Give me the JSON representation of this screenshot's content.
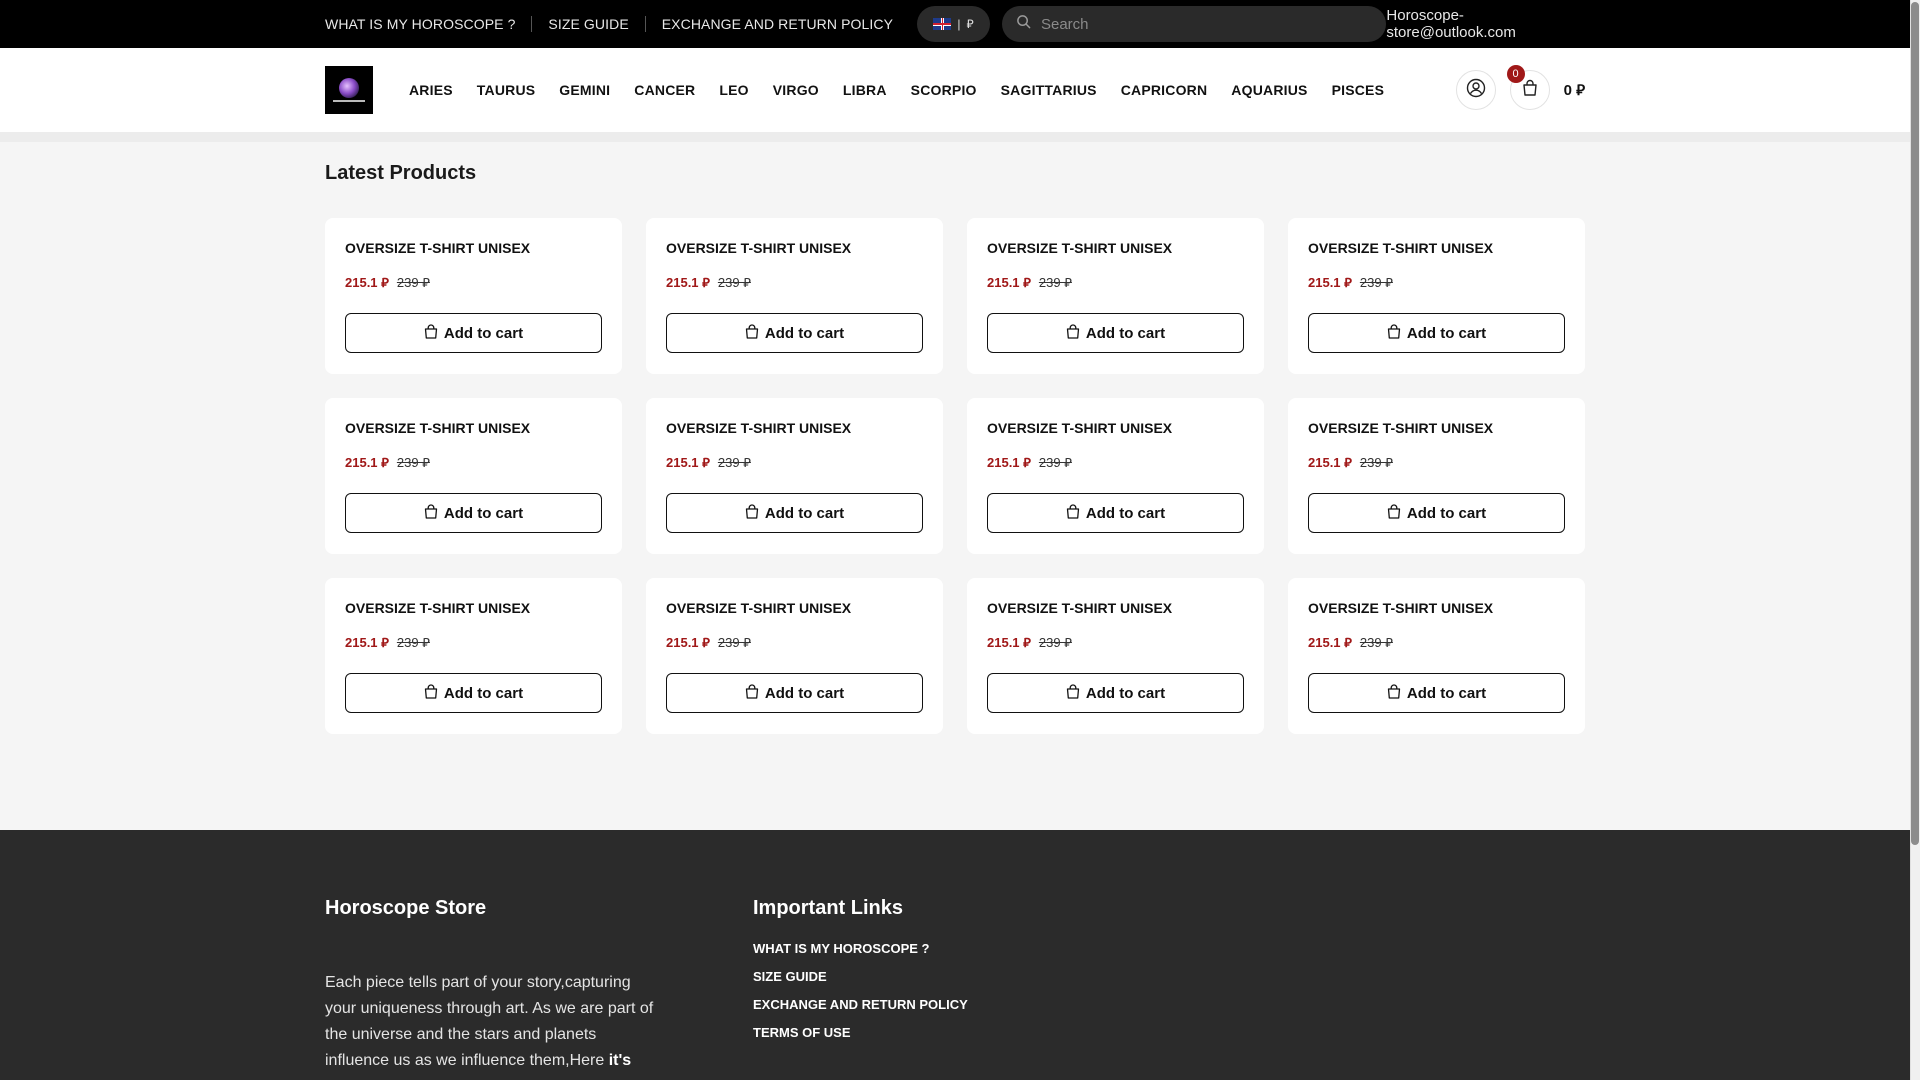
{
  "topbar": {
    "links": [
      "WHAT IS MY HOROSCOPE ?",
      "SIZE GUIDE",
      "EXCHANGE AND RETURN POLICY"
    ],
    "lang_sep": "|",
    "currency_symbol": "⃁",
    "search_placeholder": "Search",
    "email": "Horoscope-store@outlook.com"
  },
  "header": {
    "nav": [
      "ARIES",
      "TAURUS",
      "GEMINI",
      "CANCER",
      "LEO",
      "VIRGO",
      "LIBRA",
      "SCORPIO",
      "SAGITTARIUS",
      "CAPRICORN",
      "AQUARIUS",
      "PISCES"
    ],
    "cart_count": "0",
    "cart_total": "0 ⃁"
  },
  "main": {
    "section_title": "Latest Products",
    "products": [
      {
        "title": "OVERSIZE T-SHIRT UNISEX",
        "price": "215.1 ⃁",
        "old_price": "239 ⃁",
        "button": "Add to cart"
      },
      {
        "title": "OVERSIZE T-SHIRT UNISEX",
        "price": "215.1 ⃁",
        "old_price": "239 ⃁",
        "button": "Add to cart"
      },
      {
        "title": "OVERSIZE T-SHIRT UNISEX",
        "price": "215.1 ⃁",
        "old_price": "239 ⃁",
        "button": "Add to cart"
      },
      {
        "title": "OVERSIZE T-SHIRT UNISEX",
        "price": "215.1 ⃁",
        "old_price": "239 ⃁",
        "button": "Add to cart"
      },
      {
        "title": "OVERSIZE T-SHIRT UNISEX",
        "price": "215.1 ⃁",
        "old_price": "239 ⃁",
        "button": "Add to cart"
      },
      {
        "title": "OVERSIZE T-SHIRT UNISEX",
        "price": "215.1 ⃁",
        "old_price": "239 ⃁",
        "button": "Add to cart"
      },
      {
        "title": "OVERSIZE T-SHIRT UNISEX",
        "price": "215.1 ⃁",
        "old_price": "239 ⃁",
        "button": "Add to cart"
      },
      {
        "title": "OVERSIZE T-SHIRT UNISEX",
        "price": "215.1 ⃁",
        "old_price": "239 ⃁",
        "button": "Add to cart"
      },
      {
        "title": "OVERSIZE T-SHIRT UNISEX",
        "price": "215.1 ⃁",
        "old_price": "239 ⃁",
        "button": "Add to cart"
      },
      {
        "title": "OVERSIZE T-SHIRT UNISEX",
        "price": "215.1 ⃁",
        "old_price": "239 ⃁",
        "button": "Add to cart"
      },
      {
        "title": "OVERSIZE T-SHIRT UNISEX",
        "price": "215.1 ⃁",
        "old_price": "239 ⃁",
        "button": "Add to cart"
      },
      {
        "title": "OVERSIZE T-SHIRT UNISEX",
        "price": "215.1 ⃁",
        "old_price": "239 ⃁",
        "button": "Add to cart"
      }
    ]
  },
  "footer": {
    "store_title": "Horoscope Store",
    "description": "Each piece tells part of your story,capturing your uniqueness through art. As we are part of the universe and the stars and planets influence us as we influence them,Here ",
    "description_bold": "it's",
    "links_title": "Important Links",
    "links": [
      "WHAT IS MY HOROSCOPE ?",
      "SIZE GUIDE",
      "EXCHANGE AND RETURN POLICY",
      "TERMS OF USE"
    ]
  },
  "colors": {
    "topbar_bg": "#000000",
    "sale_price": "#a01818",
    "footer_bg": "#2b2b2b",
    "page_bg": "#f5f5f5"
  },
  "icons": {
    "search": "search-icon",
    "user": "user-icon",
    "cart": "shopping-bag-icon",
    "flag": "uk-flag-icon",
    "add_to_cart": "shopping-bag-icon"
  }
}
